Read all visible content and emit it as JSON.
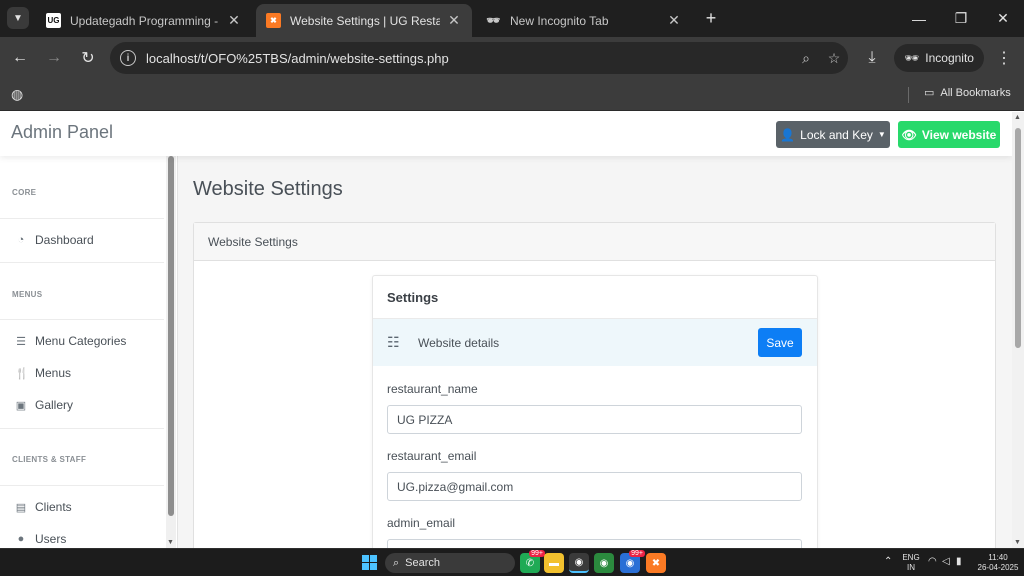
{
  "browser": {
    "tabs": [
      {
        "title": "Updategadh Programming - Upda",
        "favicon": "UG",
        "active": false
      },
      {
        "title": "Website Settings | UG Restaurant -",
        "favicon": "xampp-icon",
        "active": true
      },
      {
        "title": "New Incognito Tab",
        "favicon": "incognito-icon",
        "active": false
      }
    ],
    "url": "localhost/t/OFO%25TBS/admin/website-settings.php",
    "incognito_label": "Incognito",
    "bookmarks_label": "All Bookmarks"
  },
  "topnav": {
    "brand": "Admin Panel",
    "user_button": "Lock and Key",
    "view_button": "View website"
  },
  "sidebar": {
    "sections": [
      {
        "heading": "CORE",
        "items": [
          {
            "label": "Dashboard",
            "icon": "dashboard-icon"
          }
        ]
      },
      {
        "heading": "MENUS",
        "items": [
          {
            "label": "Menu Categories",
            "icon": "list-icon"
          },
          {
            "label": "Menus",
            "icon": "utensils-icon"
          },
          {
            "label": "Gallery",
            "icon": "image-icon"
          }
        ]
      },
      {
        "heading": "CLIENTS & STAFF",
        "items": [
          {
            "label": "Clients",
            "icon": "id-card-icon"
          },
          {
            "label": "Users",
            "icon": "user-icon"
          }
        ]
      }
    ]
  },
  "main": {
    "page_title": "Website Settings",
    "card_header": "Website Settings",
    "settings_title": "Settings",
    "details_label": "Website details",
    "save_label": "Save",
    "fields": [
      {
        "label": "restaurant_name",
        "value": "UG PIZZA"
      },
      {
        "label": "restaurant_email",
        "value": "UG.pizza@gmail.com"
      },
      {
        "label": "admin_email",
        "value": ""
      }
    ]
  },
  "taskbar": {
    "search_label": "Search",
    "badge_count": "99+",
    "lang_top": "ENG",
    "lang_bottom": "IN",
    "time": "11:40",
    "date": "26-04-2025"
  },
  "colors": {
    "view_button": "#28d96b",
    "save_button": "#0d7ef5",
    "user_button": "#5a6268"
  }
}
